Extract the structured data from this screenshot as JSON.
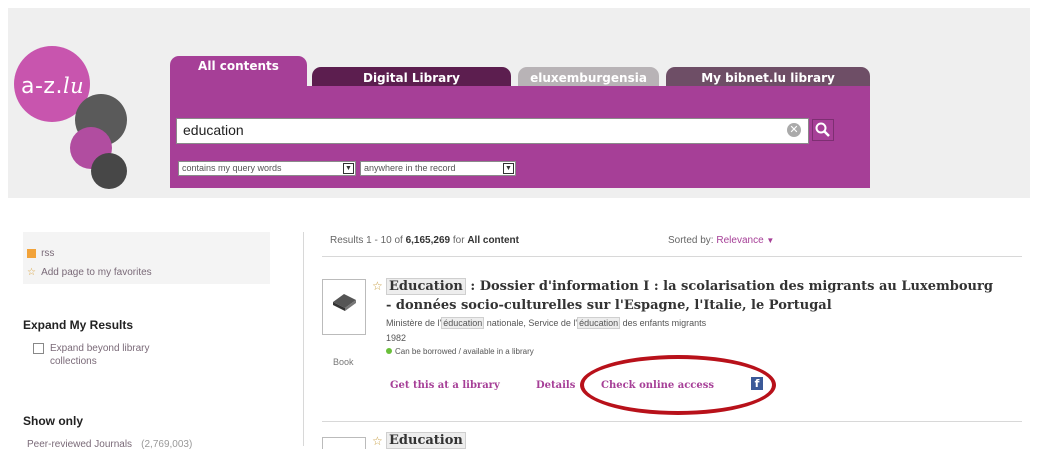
{
  "logo": {
    "prefix": "a-z.",
    "suffix": "lu"
  },
  "tabs": [
    {
      "label": "All contents",
      "active": true
    },
    {
      "label": "Digital Library",
      "active": false
    },
    {
      "label": "eluxemburgensia",
      "active": false
    },
    {
      "label": "My bibnet.lu library",
      "active": false
    }
  ],
  "search": {
    "query": "education",
    "clear_symbol": "✕",
    "match_mode": "contains my query words",
    "scope": "anywhere in the record"
  },
  "sidebar": {
    "rss_label": "rss",
    "favorites_label": "Add page to my favorites",
    "expand_heading": "Expand My Results",
    "expand_option": "Expand beyond library collections",
    "show_only_heading": "Show only",
    "peer_reviewed_label": "Peer-reviewed Journals",
    "peer_reviewed_count": "(2,769,003)"
  },
  "results": {
    "summary_prefix": "Results 1 - 10 of",
    "total": "6,165,269",
    "summary_for": "for",
    "collection": "All content",
    "sort_label": "Sorted by:",
    "sort_value": "Relevance"
  },
  "item1": {
    "type": "Book",
    "title_highlight": "Education",
    "title_line1": " : Dossier d'information I : la scolarisation des migrants au Luxembourg",
    "title_line2": "- données socio-culturelles sur l'Espagne, l'Italie, le Portugal",
    "author_1": "Ministère de l'",
    "author_hl1": "éducation",
    "author_2": " nationale, Service de l'",
    "author_hl2": "éducation",
    "author_3": " des enfants migrants",
    "year": "1982",
    "availability": "Can be borrowed / available in a library",
    "get_library": "Get this at a library",
    "details": "Details",
    "check_access": "Check online access",
    "facebook": "f"
  },
  "item2": {
    "title_highlight": "Education"
  },
  "colors": {
    "accent": "#a63f97",
    "dark_tab": "#5c1e4f",
    "circle_mark": "#b8111a"
  }
}
